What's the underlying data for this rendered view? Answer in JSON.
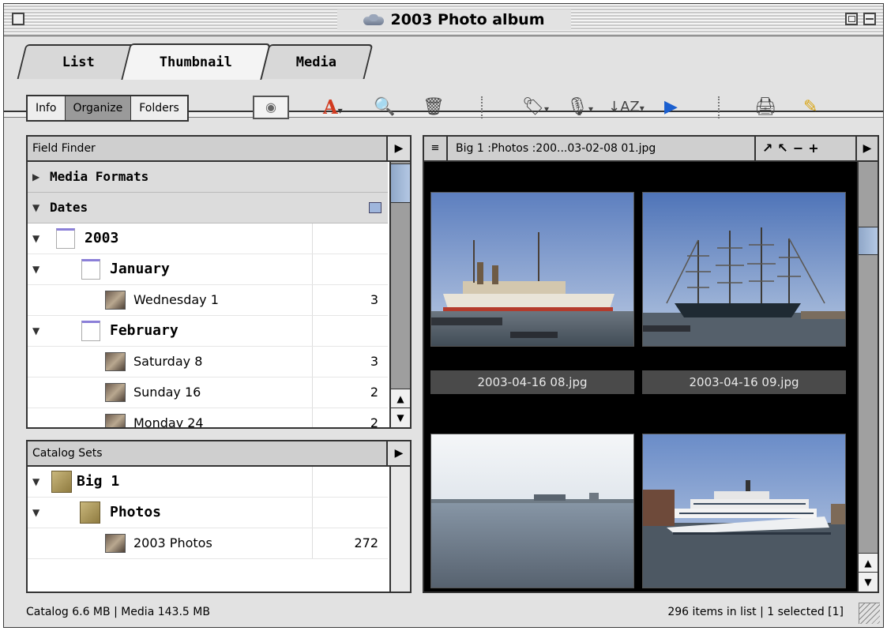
{
  "window": {
    "title": "2003 Photo album"
  },
  "tabs": [
    {
      "label": "List",
      "active": false
    },
    {
      "label": "Thumbnail",
      "active": true
    },
    {
      "label": "Media",
      "active": false
    }
  ],
  "toolbar": {
    "segments": [
      {
        "label": "Info",
        "selected": false
      },
      {
        "label": "Organize",
        "selected": true
      },
      {
        "label": "Folders",
        "selected": false
      }
    ],
    "tools": [
      "eye-icon",
      "annotation-a-icon",
      "zoom-icon",
      "trash-icon",
      "label-tag-icon",
      "microphone-icon",
      "sort-az-icon",
      "slideshow-icon",
      "print-icon",
      "edit-note-icon"
    ],
    "sort_label": "↓AZ"
  },
  "field_finder": {
    "title": "Field Finder",
    "groups": [
      {
        "label": "Media Formats",
        "expanded": false
      },
      {
        "label": "Dates",
        "expanded": true
      }
    ],
    "rows": [
      {
        "label": "2003",
        "count": "",
        "kind": "year"
      },
      {
        "label": "January",
        "count": "",
        "kind": "month"
      },
      {
        "label": "Wednesday 1",
        "count": "3",
        "kind": "day"
      },
      {
        "label": "February",
        "count": "",
        "kind": "month"
      },
      {
        "label": "Saturday 8",
        "count": "3",
        "kind": "day"
      },
      {
        "label": "Sunday 16",
        "count": "2",
        "kind": "day"
      },
      {
        "label": "Monday 24",
        "count": "2",
        "kind": "day"
      }
    ]
  },
  "catalog_sets": {
    "title": "Catalog Sets",
    "rows": [
      {
        "label": "Big 1",
        "count": "",
        "kind": "catalog"
      },
      {
        "label": "Photos",
        "count": "",
        "kind": "set"
      },
      {
        "label": "2003 Photos",
        "count": "272",
        "kind": "subset"
      }
    ]
  },
  "browser": {
    "path": "Big 1 :Photos :200...03-02-08 01.jpg",
    "controls": "↗↖−+",
    "captions": [
      "2003-04-16 08.jpg",
      "2003-04-16 09.jpg"
    ]
  },
  "status": {
    "left": "Catalog  6.6 MB  |  Media 143.5 MB",
    "right": "296 items in list  |  1 selected [1]"
  }
}
